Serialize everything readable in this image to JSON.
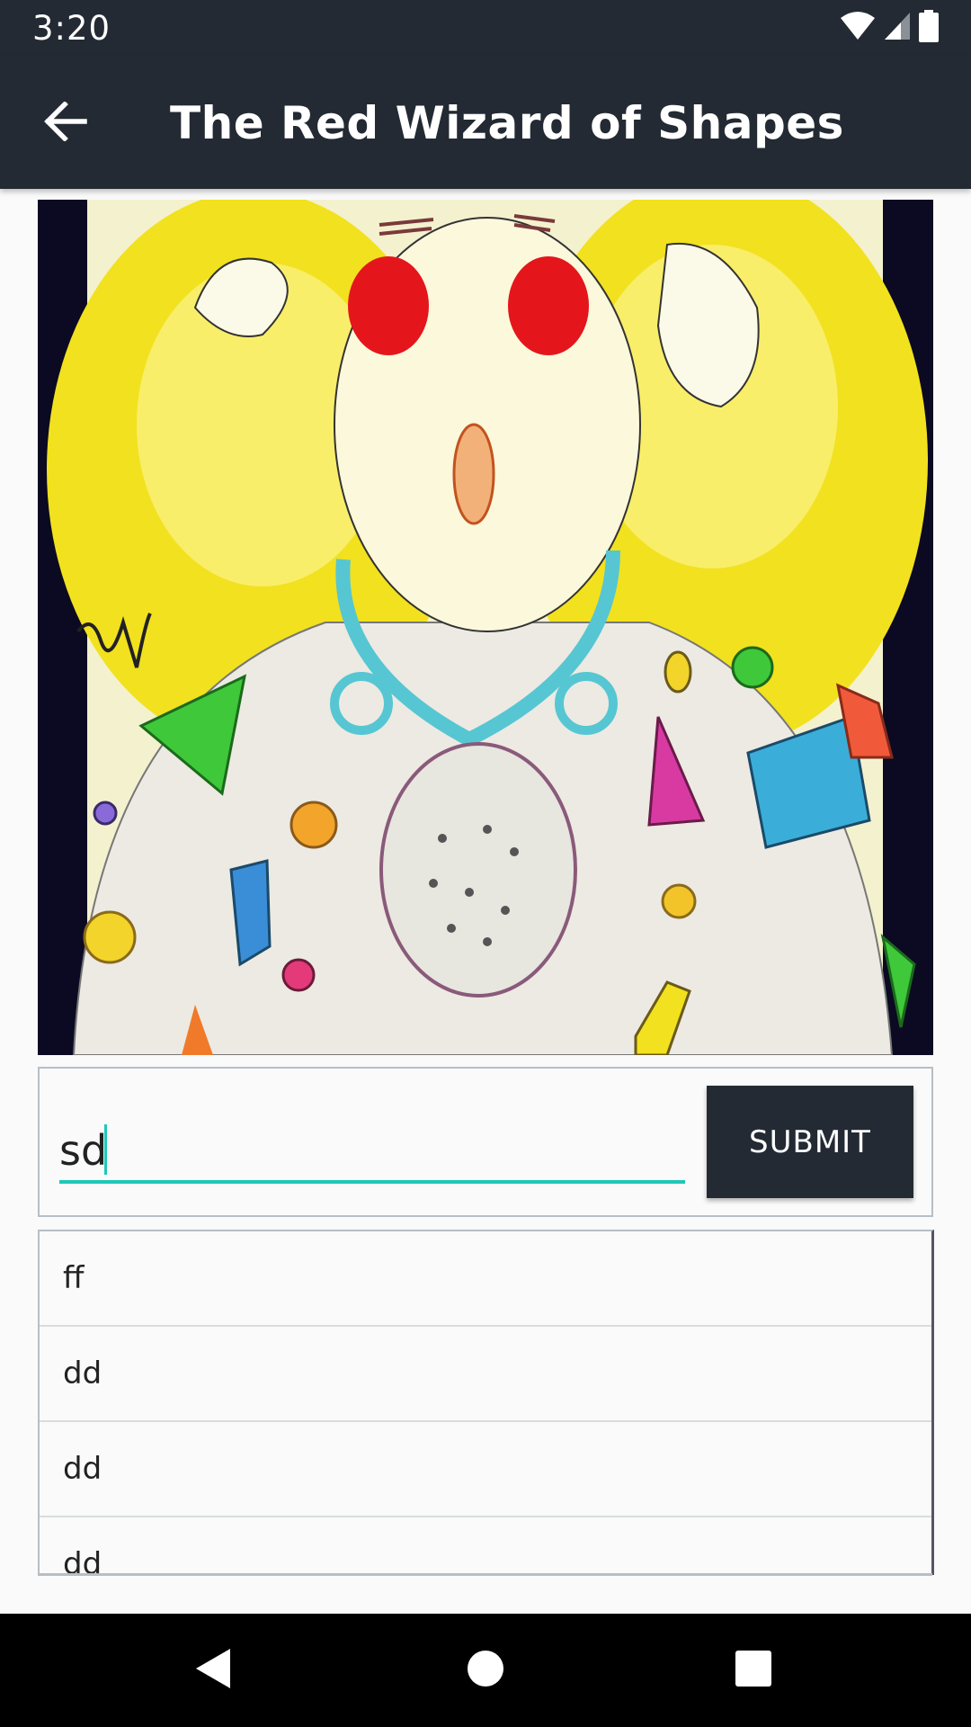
{
  "status_bar": {
    "time": "3:20",
    "icons": [
      "wifi-icon",
      "signal-icon",
      "battery-icon"
    ]
  },
  "app_bar": {
    "back_icon": "arrow-left-icon",
    "title": "The Red Wizard of Shapes"
  },
  "artwork": {
    "description_icon": "drawing-image"
  },
  "input_form": {
    "value": "sd",
    "placeholder": "",
    "submit_label": "SUBMIT",
    "accent": "#1ec8b8"
  },
  "list": {
    "items": [
      {
        "label": "ff"
      },
      {
        "label": "dd"
      },
      {
        "label": "dd"
      },
      {
        "label": "dd"
      }
    ]
  },
  "nav_bar": {
    "buttons": [
      "back-triangle-icon",
      "home-circle-icon",
      "recents-square-icon"
    ]
  },
  "colors": {
    "bar": "#232a33",
    "accent": "#1ec8b8"
  }
}
